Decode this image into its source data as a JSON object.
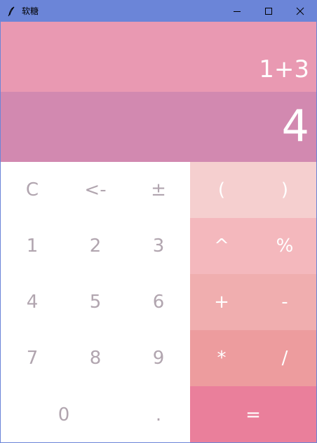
{
  "window": {
    "title": "软糖",
    "icon": "feather-pen-icon",
    "accent": "#6b85d8"
  },
  "display": {
    "expression": "1+3",
    "result": "4",
    "expression_bg": "#e999b2",
    "result_bg": "#d289b0"
  },
  "keys": {
    "clear": "C",
    "backspace": "<-",
    "plus_minus": "±",
    "open_paren": "(",
    "close_paren": ")",
    "n1": "1",
    "n2": "2",
    "n3": "3",
    "n4": "4",
    "n5": "5",
    "n6": "6",
    "n7": "7",
    "n8": "8",
    "n9": "9",
    "n0": "0",
    "dot": ".",
    "power": "^",
    "percent": "%",
    "add": "+",
    "subtract": "-",
    "multiply": "*",
    "divide": "/",
    "equals": "="
  }
}
